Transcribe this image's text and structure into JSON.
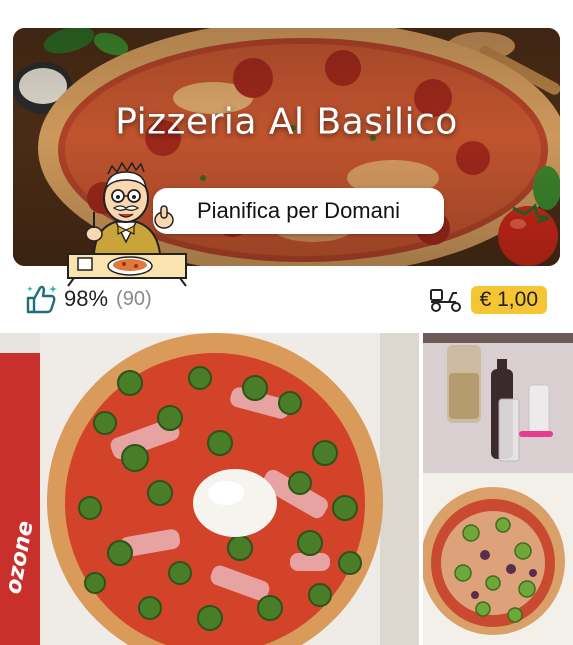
{
  "restaurant": {
    "name": "Pizzeria Al Basilico",
    "plan_label": "Pianifica per Domani"
  },
  "rating": {
    "percent": "98%",
    "count": "(90)",
    "icon": "thumbs-up-icon"
  },
  "delivery": {
    "icon": "scooter-icon",
    "price": "€ 1,00"
  },
  "photos": {
    "main_caption_text": "ozone"
  },
  "colors": {
    "price_badge": "#f5c533",
    "rating_icon": "#1f6f7a",
    "tomato_sauce": "#d94a2c",
    "crust": "#e8b77a"
  }
}
